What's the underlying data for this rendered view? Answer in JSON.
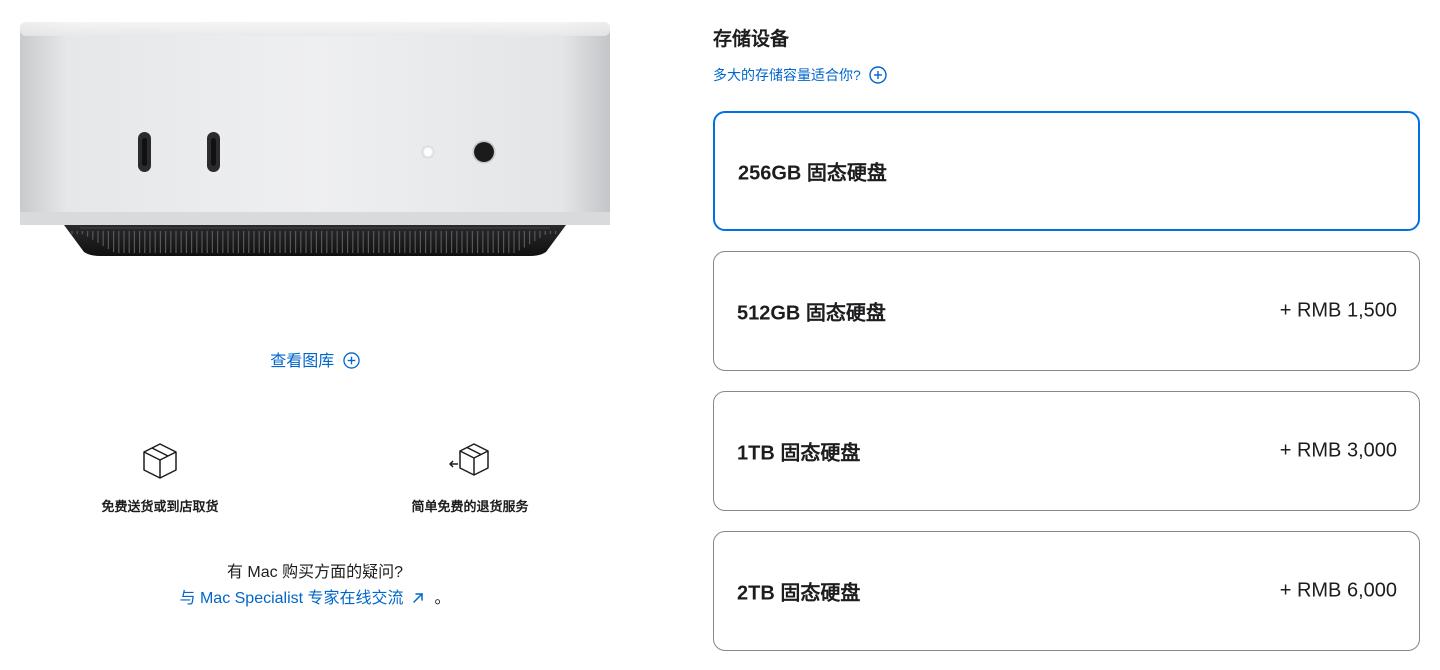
{
  "gallery": {
    "link_label": "查看图库"
  },
  "benefits": [
    {
      "icon": "box-icon",
      "label": "免费送货或到店取货"
    },
    {
      "icon": "return-box-icon",
      "label": "简单免费的退货服务"
    }
  ],
  "help": {
    "question": "有 Mac 购买方面的疑问?",
    "chat_label": "与 Mac Specialist 专家在线交流",
    "period": "。"
  },
  "storage": {
    "title": "存储设备",
    "help_link": "多大的存储容量适合你?",
    "options": [
      {
        "name": "256GB 固态硬盘",
        "price": "",
        "selected": true
      },
      {
        "name": "512GB 固态硬盘",
        "price": "+ RMB 1,500",
        "selected": false
      },
      {
        "name": "1TB 固态硬盘",
        "price": "+ RMB 3,000",
        "selected": false
      },
      {
        "name": "2TB 固态硬盘",
        "price": "+ RMB 6,000",
        "selected": false
      }
    ]
  },
  "colors": {
    "link": "#0066cc",
    "selected_border": "#0071e3",
    "option_border": "#86868b",
    "text": "#1d1d1f"
  }
}
